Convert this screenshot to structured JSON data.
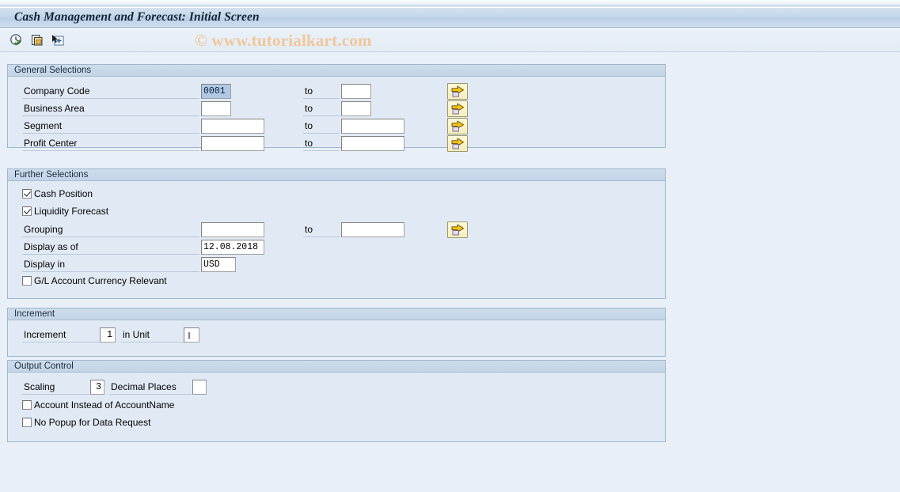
{
  "window": {
    "title": "Cash Management and Forecast: Initial Screen"
  },
  "watermark": {
    "text": "© www.tutorialkart.com"
  },
  "toolbar": {
    "buttons": [
      {
        "name": "execute-icon",
        "tooltip": "Execute"
      },
      {
        "name": "multiple-selection-icon",
        "tooltip": "Multiple Selection"
      },
      {
        "name": "get-variant-icon",
        "tooltip": "Get Variant"
      }
    ]
  },
  "colors": {
    "title_bar": "#c3d6e8",
    "panel_bg": "#e1eaf4",
    "panel_header": "#c8d9ea",
    "canvas_bg": "#e9eff6",
    "selection": "#b0c8e4",
    "button_yellow": "#f6edbe",
    "arrow_yellow": "#f5c518",
    "watermark": "#f0c79a"
  },
  "sections": {
    "general_selections": {
      "title": "General Selections",
      "to_label": "to",
      "rows": [
        {
          "label": "Company Code",
          "value": "0001",
          "selected": true,
          "to_value": "",
          "size": "small"
        },
        {
          "label": "Business Area",
          "value": "",
          "selected": false,
          "to_value": "",
          "size": "small"
        },
        {
          "label": "Segment",
          "value": "",
          "selected": false,
          "to_value": "",
          "size": "large"
        },
        {
          "label": "Profit Center",
          "value": "",
          "selected": false,
          "to_value": "",
          "size": "large"
        }
      ]
    },
    "further_selections": {
      "title": "Further Selections",
      "to_label": "to",
      "checkboxes_top": [
        {
          "label": "Cash Position",
          "checked": true
        },
        {
          "label": "Liquidity Forecast",
          "checked": true
        }
      ],
      "grouping": {
        "label": "Grouping",
        "value": "",
        "to_value": ""
      },
      "display_as_of": {
        "label": "Display as of",
        "value": "12.08.2018"
      },
      "display_in": {
        "label": "Display in",
        "value": "USD"
      },
      "checkbox_bottom": {
        "label": "G/L Account Currency Relevant",
        "checked": false
      }
    },
    "increment": {
      "title": "Increment",
      "increment": {
        "label": "Increment",
        "value": "1"
      },
      "unit": {
        "label": "in Unit",
        "value": ""
      }
    },
    "output_control": {
      "title": "Output Control",
      "scaling": {
        "label": "Scaling",
        "value": "3"
      },
      "decimal_places": {
        "label": "Decimal Places",
        "value": ""
      },
      "checkboxes": [
        {
          "label": "Account Instead of AccountName",
          "checked": false
        },
        {
          "label": "No Popup for Data Request",
          "checked": false
        }
      ]
    }
  }
}
